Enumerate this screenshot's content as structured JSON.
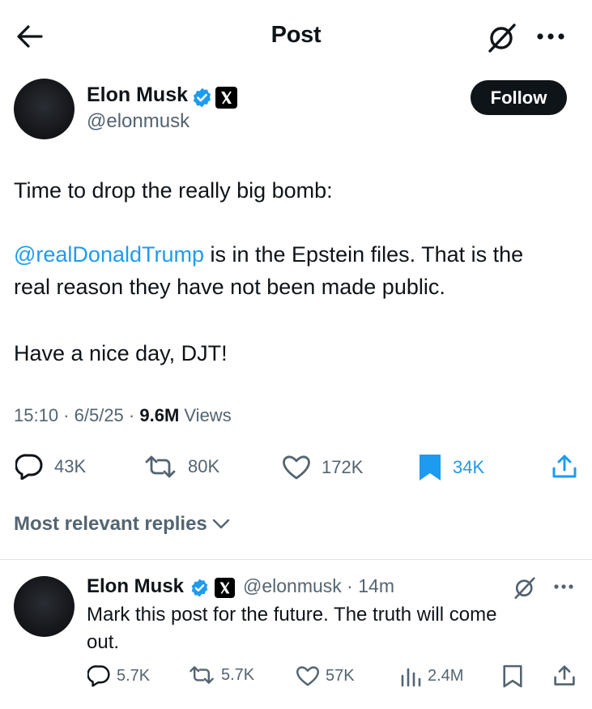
{
  "header": {
    "title": "Post"
  },
  "post": {
    "author_name": "Elon Musk",
    "author_handle": "@elonmusk",
    "follow_label": "Follow",
    "lines": {
      "l1": "Time to drop the really big bomb:",
      "mention": "@realDonaldTrump",
      "l2_rest": " is in the Epstein files. That is the",
      "l3": "real reason they have not been made public.",
      "l4": "Have a nice day, DJT!"
    },
    "time": "15:10",
    "date": "6/5/25",
    "views_count": "9.6M",
    "views_label": "Views",
    "actions": {
      "replies": "43K",
      "reposts": "80K",
      "likes": "172K",
      "bookmarks": "34K"
    }
  },
  "replies_sort_label": "Most relevant replies",
  "reply": {
    "author_name": "Elon Musk",
    "author_handle": "@elonmusk",
    "age": "14m",
    "line1": "Mark this post for the future. The truth will come",
    "line2": "out.",
    "actions": {
      "replies": "5.7K",
      "reposts": "5.7K",
      "likes": "57K",
      "views": "2.4M"
    }
  },
  "colors": {
    "accent": "#1d9bf0",
    "text": "#0f1419",
    "muted": "#536471",
    "follow_bg": "#0f1419"
  }
}
